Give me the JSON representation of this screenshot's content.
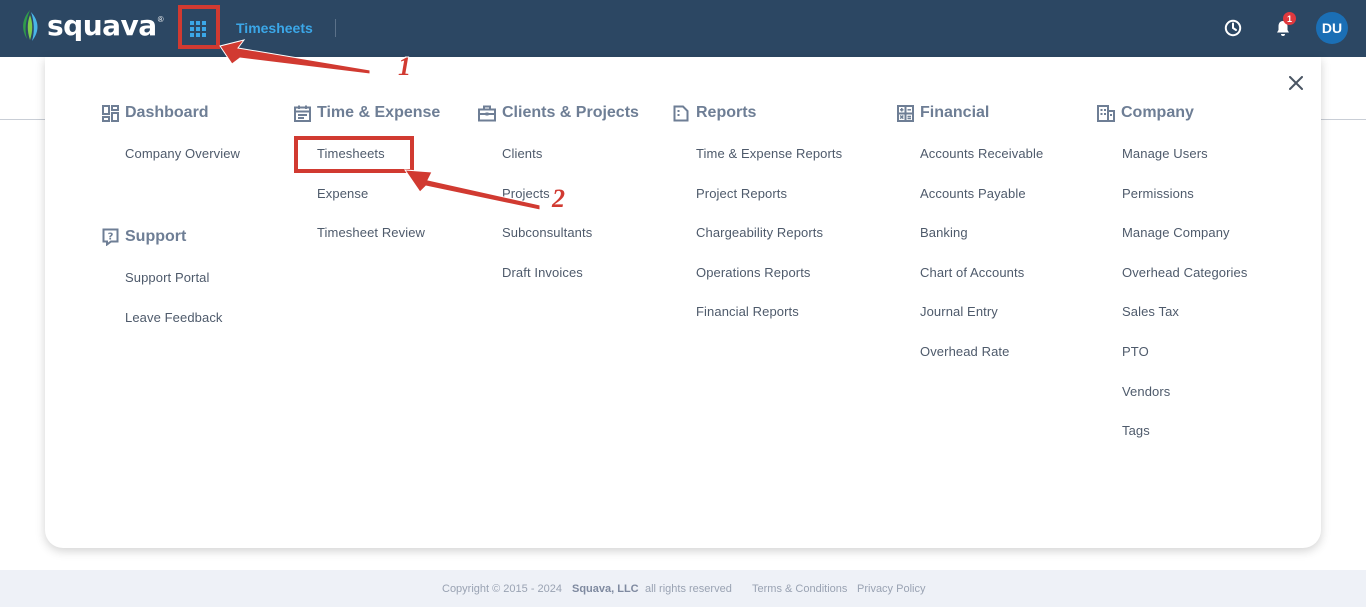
{
  "topbar": {
    "logo_text": "squava",
    "logo_reg": "®",
    "title": "Timesheets",
    "avatar_initials": "DU",
    "notification_count": "1",
    "icons": {
      "apps": "grid-icon",
      "clock": "clock-icon",
      "bell": "bell-icon"
    }
  },
  "menu": {
    "dashboard": {
      "heading": "Dashboard",
      "icon": "dashboard-icon",
      "items": [
        "Company Overview"
      ]
    },
    "support": {
      "heading": "Support",
      "icon": "help-icon",
      "items": [
        "Support Portal",
        "Leave Feedback"
      ]
    },
    "time_expense": {
      "heading": "Time & Expense",
      "icon": "calendar-icon",
      "items": [
        "Timesheets",
        "Expense",
        "Timesheet Review"
      ]
    },
    "clients_projects": {
      "heading": "Clients & Projects",
      "icon": "briefcase-icon",
      "items": [
        "Clients",
        "Projects",
        "Subconsultants",
        "Draft Invoices"
      ]
    },
    "reports": {
      "heading": "Reports",
      "icon": "report-icon",
      "items": [
        "Time & Expense Reports",
        "Project Reports",
        "Chargeability Reports",
        "Operations Reports",
        "Financial Reports"
      ]
    },
    "financial": {
      "heading": "Financial",
      "icon": "calculator-icon",
      "items": [
        "Accounts Receivable",
        "Accounts Payable",
        "Banking",
        "Chart of Accounts",
        "Journal Entry",
        "Overhead Rate"
      ]
    },
    "company": {
      "heading": "Company",
      "icon": "building-icon",
      "items": [
        "Manage Users",
        "Permissions",
        "Manage Company",
        "Overhead Categories",
        "Sales Tax",
        "PTO",
        "Vendors",
        "Tags"
      ]
    }
  },
  "annotations": {
    "step1": "1",
    "step2": "2"
  },
  "footer": {
    "copyright": "Copyright © 2015 - 2024",
    "company": "Squava, LLC",
    "rights": "all rights reserved",
    "terms": "Terms & Conditions",
    "privacy": "Privacy Policy"
  },
  "colors": {
    "topbar": "#2c4763",
    "accent": "#3ba7e8",
    "annotation": "#d13a31",
    "heading": "#6e7e95"
  }
}
